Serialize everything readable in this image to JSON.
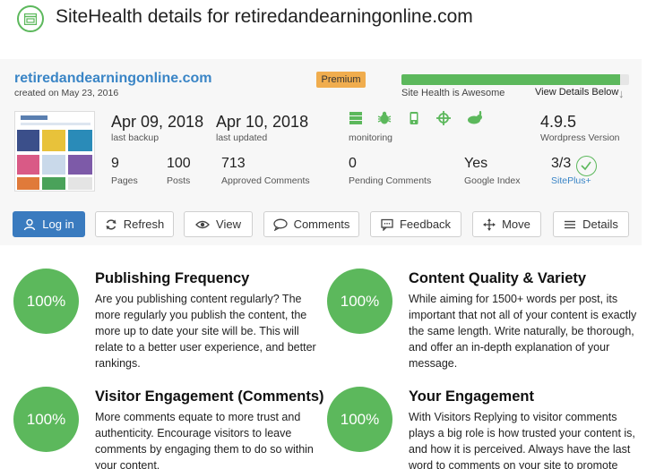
{
  "title": "SiteHealth details for retiredandearningonline.com",
  "site": {
    "name": "retiredandearningonline.com",
    "created": "created on May 23, 2016",
    "badge": "Premium"
  },
  "health": {
    "percent": 96,
    "label": "Site Health is Awesome",
    "details_link": "View Details Below",
    "color": "#5cb85c"
  },
  "stats": {
    "last_backup": {
      "value": "Apr 09, 2018",
      "label": "last backup"
    },
    "last_updated": {
      "value": "Apr 10, 2018",
      "label": "last updated"
    },
    "monitoring_label": "monitoring",
    "monitoring_icons": [
      "server-icon",
      "bug-icon",
      "mobile-icon",
      "crosshair-icon",
      "rabbit-icon"
    ],
    "wp_version": {
      "value": "4.9.5",
      "label": "Wordpress Version"
    },
    "pages": {
      "value": "9",
      "label": "Pages"
    },
    "posts": {
      "value": "100",
      "label": "Posts"
    },
    "approved_comments": {
      "value": "713",
      "label": "Approved Comments"
    },
    "pending_comments": {
      "value": "0",
      "label": "Pending Comments"
    },
    "google_index": {
      "value": "Yes",
      "label": "Google Index"
    },
    "siteplus": {
      "value": "3/3",
      "label": "SitePlus+"
    }
  },
  "actions": {
    "login": "Log in",
    "refresh": "Refresh",
    "view": "View",
    "comments": "Comments",
    "feedback": "Feedback",
    "move": "Move",
    "details": "Details"
  },
  "cards": [
    {
      "percent": "100%",
      "title": "Publishing Frequency",
      "text": "Are you publishing content regularly? The more regularly you publish the content, the more up to date your site will be. This will relate to a better user experience, and better rankings."
    },
    {
      "percent": "100%",
      "title": "Content Quality & Variety",
      "text": "While aiming for 1500+ words per post, its important that not all of your content is exactly the same length. Write naturally, be thorough, and offer an in-depth explanation of your message."
    },
    {
      "percent": "100%",
      "title": "Visitor Engagement (Comments)",
      "text": "More comments equate to more trust and authenticity. Encourage visitors to leave comments by engaging them to do so within your content."
    },
    {
      "percent": "100%",
      "title": "Your Engagement",
      "text": "With Visitors Replying to visitor comments plays a big role is how trusted your content is, and how it is perceived. Always have the last word to comments on your site to promote"
    }
  ],
  "colors": {
    "accent_blue": "#3a7bbf",
    "link_blue": "#3a85c6",
    "green": "#5cb85c",
    "premium_orange": "#f0ad4e"
  }
}
